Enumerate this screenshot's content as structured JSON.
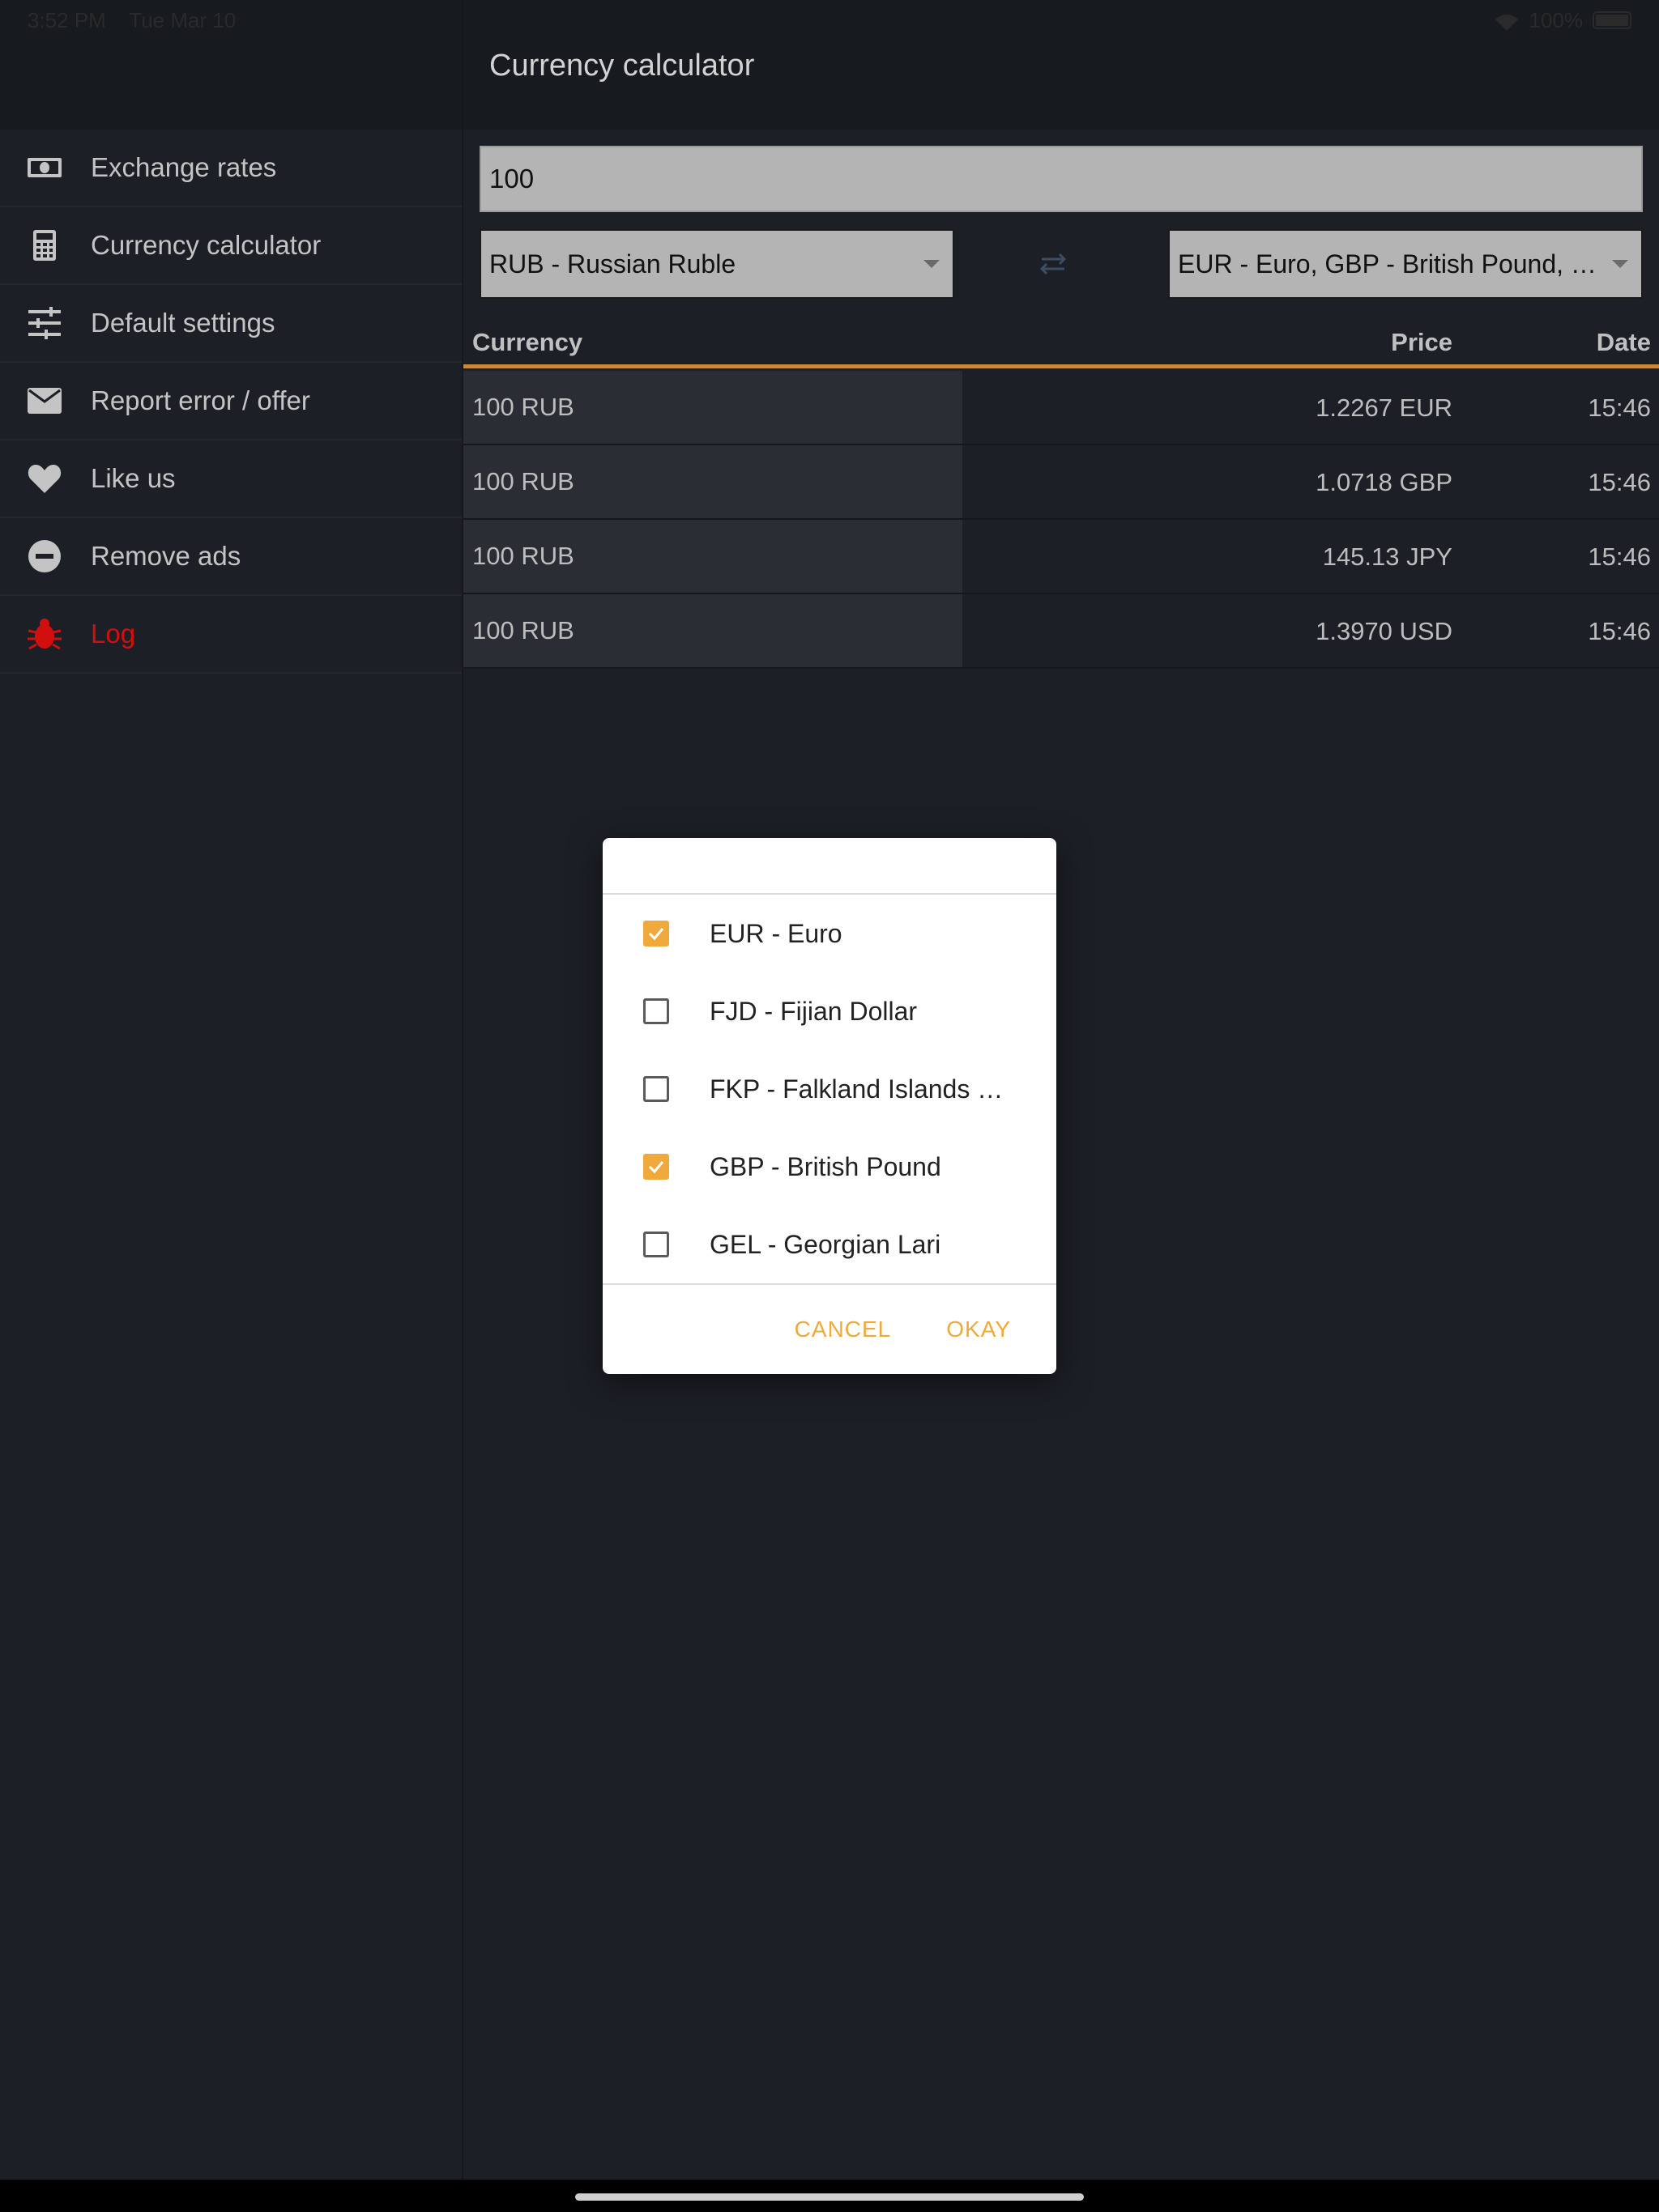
{
  "status": {
    "time": "3:52 PM",
    "date": "Tue Mar 10",
    "battery": "100%"
  },
  "sidebar": {
    "items": [
      {
        "label": "Exchange rates",
        "icon": "banknote-icon"
      },
      {
        "label": "Currency calculator",
        "icon": "calculator-icon"
      },
      {
        "label": "Default settings",
        "icon": "sliders-icon"
      },
      {
        "label": "Report error / offer",
        "icon": "mail-icon"
      },
      {
        "label": "Like us",
        "icon": "heart-icon"
      },
      {
        "label": "Remove ads",
        "icon": "minus-circle-icon"
      },
      {
        "label": "Log",
        "icon": "bug-icon"
      }
    ]
  },
  "main": {
    "title": "Currency calculator",
    "amount": "100",
    "from_currency": "RUB - Russian Ruble",
    "to_currencies": "EUR - Euro, GBP - British Pound, …",
    "table": {
      "headers": {
        "currency": "Currency",
        "price": "Price",
        "date": "Date"
      },
      "rows": [
        {
          "currency": "100 RUB",
          "price": "1.2267 EUR",
          "date": "15:46"
        },
        {
          "currency": "100 RUB",
          "price": "1.0718 GBP",
          "date": "15:46"
        },
        {
          "currency": "100 RUB",
          "price": "145.13 JPY",
          "date": "15:46"
        },
        {
          "currency": "100 RUB",
          "price": "1.3970 USD",
          "date": "15:46"
        }
      ]
    }
  },
  "dialog": {
    "items": [
      {
        "label": "EUR - Euro",
        "checked": true
      },
      {
        "label": "FJD - Fijian Dollar",
        "checked": false
      },
      {
        "label": "FKP - Falkland Islands …",
        "checked": false
      },
      {
        "label": "GBP - British Pound",
        "checked": true
      },
      {
        "label": "GEL - Georgian Lari",
        "checked": false
      }
    ],
    "cancel_label": "CANCEL",
    "okay_label": "OKAY"
  },
  "colors": {
    "accent": "#f0a93c",
    "table_underline": "#c8893a",
    "log_red": "#d10f0f",
    "background": "#1c1f26"
  }
}
